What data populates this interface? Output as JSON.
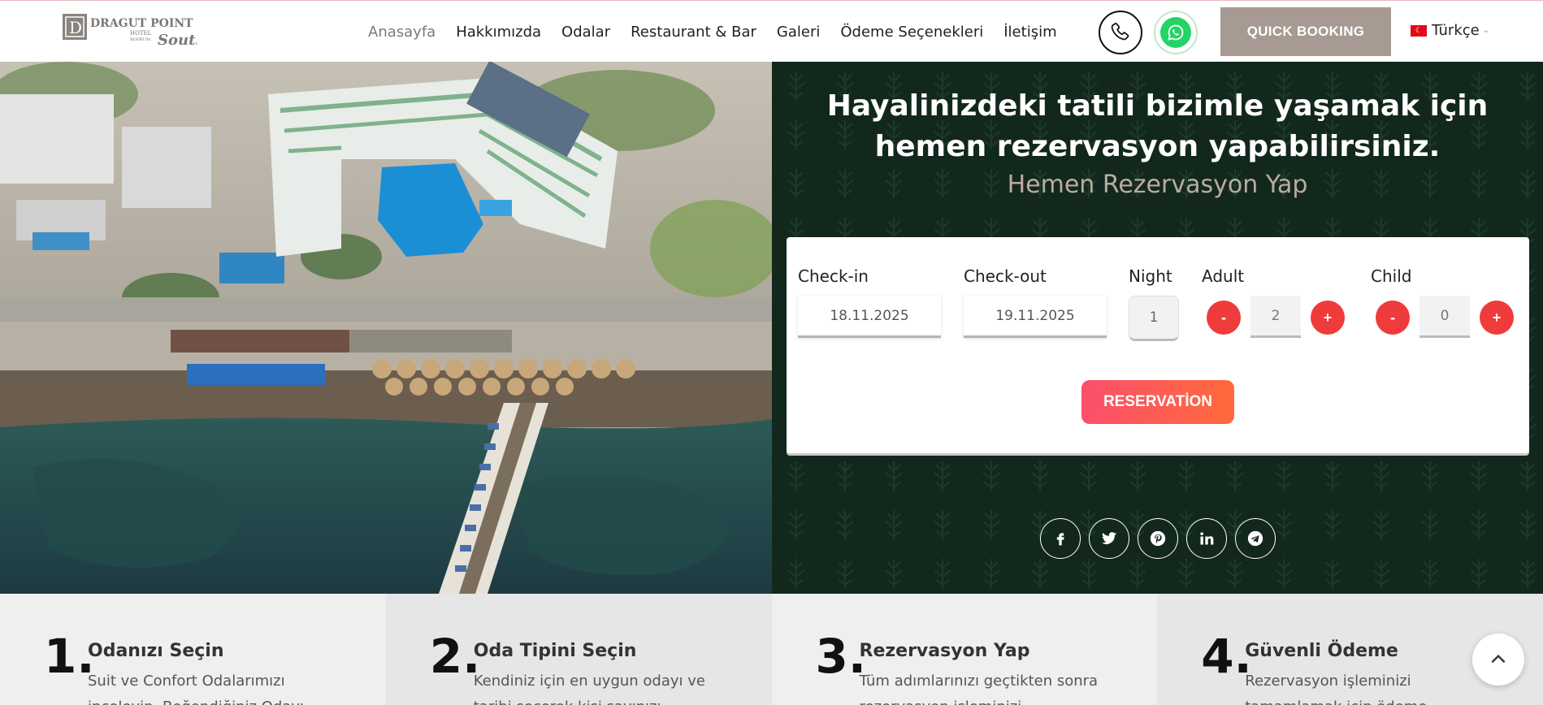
{
  "header": {
    "logo": {
      "brand": "Dragut Point",
      "sub": "Hotel",
      "place": "Bodrum",
      "script": "South"
    },
    "nav": [
      {
        "label": "Anasayfa",
        "active": true
      },
      {
        "label": "Hakkımızda"
      },
      {
        "label": "Odalar"
      },
      {
        "label": "Restaurant & Bar"
      },
      {
        "label": "Galeri"
      },
      {
        "label": "Ödeme Seçenekleri"
      },
      {
        "label": "İletişim"
      }
    ],
    "phone_icon": "phone-icon",
    "whatsapp_icon": "whatsapp-icon",
    "quick_booking": "QUICK BOOKING",
    "language": "Türkçe",
    "accent": "#a69a92"
  },
  "hero": {
    "title": "Hayalinizdeki tatili bizimle yaşamak için hemen rezervasyon yapabilirsiniz.",
    "subtitle": "Hemen Rezervasyon Yap",
    "panel_color": "#13281d"
  },
  "booking": {
    "checkin_label": "Check-in",
    "checkin_value": "18.11.2025",
    "checkout_label": "Check-out",
    "checkout_value": "19.11.2025",
    "night_label": "Night",
    "night_value": "1",
    "adult_label": "Adult",
    "adult_value": "2",
    "child_label": "Child",
    "child_value": "0",
    "minus": "-",
    "plus": "+",
    "reserve": "RESERVATİON",
    "button_color": "#ef3b3b"
  },
  "socials": [
    "facebook-icon",
    "twitter-icon",
    "pinterest-icon",
    "linkedin-icon",
    "telegram-icon"
  ],
  "steps": [
    {
      "num": "1.",
      "title": "Odanızı Seçin",
      "text": "Suit ve Confort Odalarımızı inceleyin. Beğendiğiniz Odayı"
    },
    {
      "num": "2.",
      "title": "Oda Tipini Seçin",
      "text": "Kendiniz için en uygun odayı ve tarihi seçerek kişi sayınızı"
    },
    {
      "num": "3.",
      "title": "Rezervasyon Yap",
      "text": "Tüm adımlarınızı geçtikten sonra rezervasyon işleminizi"
    },
    {
      "num": "4.",
      "title": "Güvenli Ödeme",
      "text": "Rezervasyon işleminizi tamamlamak için ödeme"
    }
  ],
  "scroll_top_icon": "chevron-up-icon"
}
